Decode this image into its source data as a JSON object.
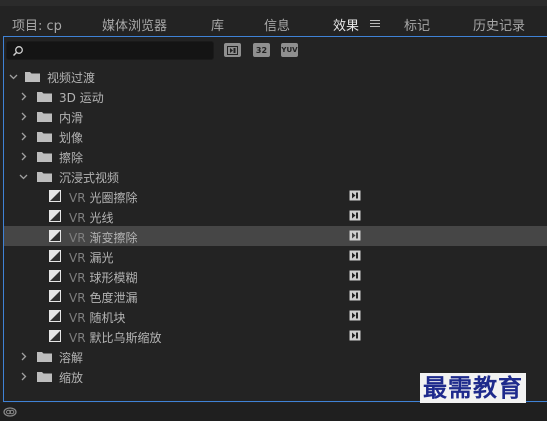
{
  "tabs": [
    {
      "label": "项目: cp",
      "active": false
    },
    {
      "label": "媒体浏览器",
      "active": false
    },
    {
      "label": "库",
      "active": false
    },
    {
      "label": "信息",
      "active": false
    },
    {
      "label": "效果",
      "active": true
    },
    {
      "label": "标记",
      "active": false
    },
    {
      "label": "历史记录",
      "active": false
    }
  ],
  "search": {
    "value": "",
    "placeholder": ""
  },
  "filters": {
    "accelerated": "accelerated-effects-icon",
    "bit32": "32",
    "yuv": "YUV"
  },
  "tree": {
    "root": {
      "label": "视频过渡",
      "expanded": true
    },
    "folders_before": [
      "3D 运动",
      "内滑",
      "划像",
      "擦除"
    ],
    "immersive": {
      "label": "沉浸式视频",
      "expanded": true
    },
    "vr_prefix": "VR",
    "immersive_items": [
      {
        "name": "光圈擦除",
        "selected": false
      },
      {
        "name": "光线",
        "selected": false
      },
      {
        "name": "渐变擦除",
        "selected": true
      },
      {
        "name": "漏光",
        "selected": false
      },
      {
        "name": "球形模糊",
        "selected": false
      },
      {
        "name": "色度泄漏",
        "selected": false
      },
      {
        "name": "随机块",
        "selected": false
      },
      {
        "name": "默比乌斯缩放",
        "selected": false
      }
    ],
    "folders_after": [
      "溶解",
      "缩放"
    ]
  },
  "watermark": "最需教育",
  "colors": {
    "accent": "#3f82d6",
    "selected_row": "#464646",
    "background": "#232323"
  }
}
